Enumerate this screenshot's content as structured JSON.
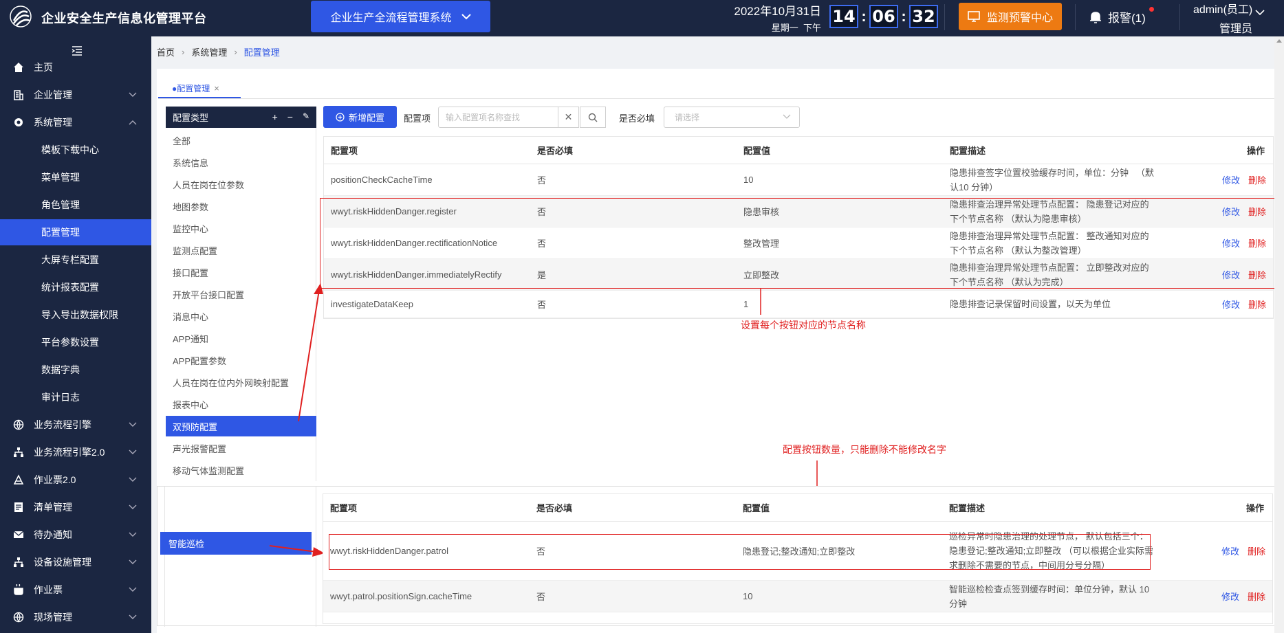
{
  "header": {
    "app_title": "企业安全生产信息化管理平台",
    "system_switch": "企业生产全流程管理系统",
    "date": "2022年10月31日",
    "weekday": "星期一",
    "ampm": "下午",
    "clock": {
      "hh": "14",
      "mm": "06",
      "ss": "32"
    },
    "monitor_label": "监测预警中心",
    "alarm_label": "报警(1)",
    "user_name": "admin(员工)",
    "user_role": "管理员"
  },
  "sidebar": {
    "items": [
      {
        "label": "主页",
        "icon": "home-icon"
      },
      {
        "label": "企业管理",
        "icon": "building-icon"
      },
      {
        "label": "系统管理",
        "icon": "settings-icon"
      },
      {
        "label": "模板下载中心"
      },
      {
        "label": "菜单管理"
      },
      {
        "label": "角色管理"
      },
      {
        "label": "配置管理"
      },
      {
        "label": "大屏专栏配置"
      },
      {
        "label": "统计报表配置"
      },
      {
        "label": "导入导出数据权限"
      },
      {
        "label": "平台参数设置"
      },
      {
        "label": "数据字典"
      },
      {
        "label": "审计日志"
      },
      {
        "label": "业务流程引擎",
        "icon": "workflow-icon"
      },
      {
        "label": "业务流程引擎2.0",
        "icon": "network-icon"
      },
      {
        "label": "作业票2.0",
        "icon": "ticket-icon"
      },
      {
        "label": "清单管理",
        "icon": "list-icon"
      },
      {
        "label": "待办通知",
        "icon": "mail-icon"
      },
      {
        "label": "设备设施管理",
        "icon": "device-icon"
      },
      {
        "label": "作业票",
        "icon": "pot-icon"
      },
      {
        "label": "现场管理",
        "icon": "site-icon"
      }
    ]
  },
  "breadcrumb": {
    "home": "首页",
    "section": "系统管理",
    "current": "配置管理"
  },
  "tab": {
    "label": "●配置管理",
    "close": "×"
  },
  "type_panel": {
    "title": "配置类型",
    "tools": {
      "add": "+",
      "remove": "−",
      "edit": "✎"
    },
    "items": [
      "全部",
      "系统信息",
      "人员在岗在位参数",
      "地图参数",
      "监控中心",
      "监测点配置",
      "接口配置",
      "开放平台接口配置",
      "消息中心",
      "APP通知",
      "APP配置参数",
      "人员在岗在位内外网映射配置",
      "报表中心",
      "双预防配置",
      "声光报警配置",
      "移动气体监测配置"
    ],
    "active_index": 13
  },
  "toolbar": {
    "add_label": "新增配置",
    "config_item_label": "配置项",
    "search_placeholder": "输入配置项名称查找",
    "clear": "✕",
    "required_label": "是否必填",
    "select_placeholder": "请选择"
  },
  "table": {
    "columns": [
      "配置项",
      "是否必填",
      "配置值",
      "配置描述",
      "操作"
    ],
    "rows": [
      {
        "key": "positionCheckCacheTime",
        "required": "否",
        "value": "10",
        "desc": "隐患排查签字位置校验缓存时间，单位：分钟   （默认10 分钟）",
        "edit": "修改",
        "del": "删除"
      },
      {
        "key": "wwyt.riskHiddenDanger.register",
        "required": "否",
        "value": "隐患审核",
        "desc": "隐患排查治理异常处理节点配置： 隐患登记对应的下个节点名称 （默认为隐患审核）",
        "edit": "修改",
        "del": "删除"
      },
      {
        "key": "wwyt.riskHiddenDanger.rectificationNotice",
        "required": "否",
        "value": "整改管理",
        "desc": "隐患排查治理异常处理节点配置： 整改通知对应的下个节点名称 （默认为整改管理）",
        "edit": "修改",
        "del": "删除"
      },
      {
        "key": "wwyt.riskHiddenDanger.immediatelyRectify",
        "required": "是",
        "value": "立即整改",
        "desc": "隐患排查治理异常处理节点配置： 立即整改对应的下个节点名称 （默认为完成）",
        "edit": "修改",
        "del": "删除"
      },
      {
        "key": "investigateDataKeep",
        "required": "否",
        "value": "1",
        "desc": "隐患排查记录保留时间设置，以天为单位",
        "edit": "修改",
        "del": "删除"
      }
    ]
  },
  "annotations": {
    "note1": "设置每个按钮对应的节点名称",
    "note2": "配置按钮数量，只能删除不能修改名字"
  },
  "lower": {
    "chip_label": "智能巡检",
    "columns": [
      "配置项",
      "是否必填",
      "配置值",
      "配置描述",
      "操作"
    ],
    "rows": [
      {
        "key": "wwyt.riskHiddenDanger.patrol",
        "required": "否",
        "value": "隐患登记;整改通知;立即整改",
        "desc": "巡检异常时隐患治理的处理节点， 默认包括三个： 隐患登记;整改通知;立即整改 （可以根据企业实际需求删除不需要的节点，中间用分号分隔）",
        "edit": "修改",
        "del": "删除"
      },
      {
        "key": "wwyt.patrol.positionSign.cacheTime",
        "required": "否",
        "value": "10",
        "desc": "智能巡检检查点签到缓存时间：单位分钟，默认 10 分钟",
        "edit": "修改",
        "del": "删除"
      }
    ]
  },
  "colors": {
    "nav_bg": "#1b2641",
    "accent": "#2f57e4",
    "warn": "#ed7a12",
    "danger": "#e02020"
  }
}
